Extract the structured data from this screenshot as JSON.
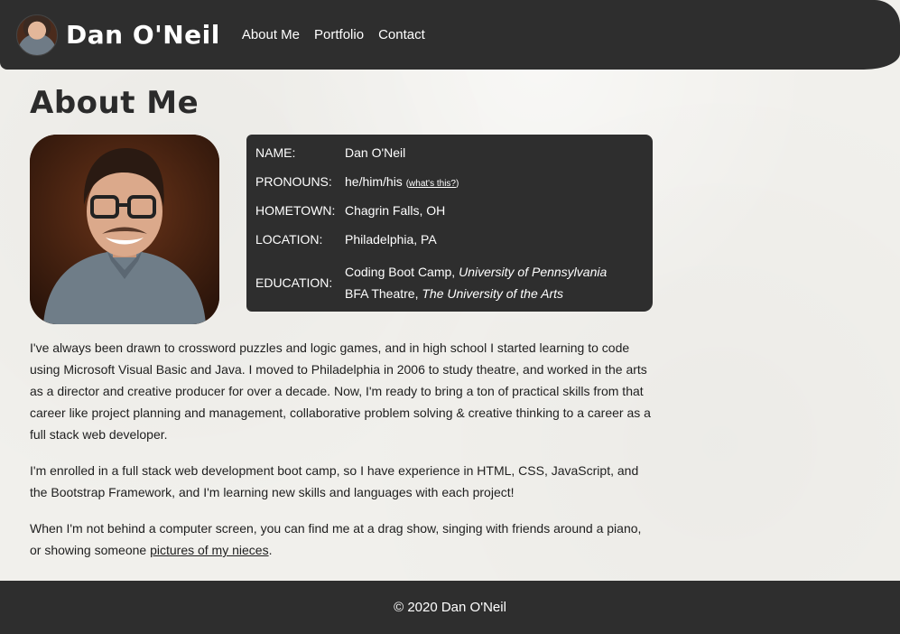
{
  "navbar": {
    "brand": "Dan O'Neil",
    "links": [
      "About Me",
      "Portfolio",
      "Contact"
    ]
  },
  "page": {
    "title": "About Me"
  },
  "info": {
    "name_label": "NAME:",
    "name_value": "Dan O'Neil",
    "pronouns_label": "PRONOUNS:",
    "pronouns_value": "he/him/his",
    "pronouns_link_open": "(",
    "pronouns_link": "what's this?",
    "pronouns_link_close": ")",
    "hometown_label": "HOMETOWN:",
    "hometown_value": "Chagrin Falls, OH",
    "location_label": "LOCATION:",
    "location_value": "Philadelphia, PA",
    "education_label": "EDUCATION:",
    "education_1_degree": "Coding Boot Camp, ",
    "education_1_school": "University of Pennsylvania",
    "education_2_degree": "BFA Theatre, ",
    "education_2_school": "The University of the Arts"
  },
  "bio": {
    "p1": "I've always been drawn to crossword puzzles and logic games, and in high school I started learning to code using Microsoft Visual Basic and Java. I moved to Philadelphia in 2006 to study theatre, and worked in the arts as a director and creative producer for over a decade. Now, I'm ready to bring a ton of practical skills from that career like project planning and management, collaborative problem solving & creative thinking to a career as a full stack web developer.",
    "p2": "I'm enrolled in a full stack web development boot camp, so I have experience in HTML, CSS, JavaScript, and the Bootstrap Framework, and I'm learning new skills and languages with each project!",
    "p3_text": "When I'm not behind a computer screen, you can find me at a drag show, singing with friends around a piano, or showing someone ",
    "p3_link": "pictures of my nieces",
    "p3_end": "."
  },
  "footer": {
    "copyright": "© 2020 Dan O'Neil"
  },
  "colors": {
    "dark_panel": "#2e2e2e",
    "page_background": "#f1f0ec",
    "text": "#1e1e1e",
    "light_text": "#ffffff"
  }
}
